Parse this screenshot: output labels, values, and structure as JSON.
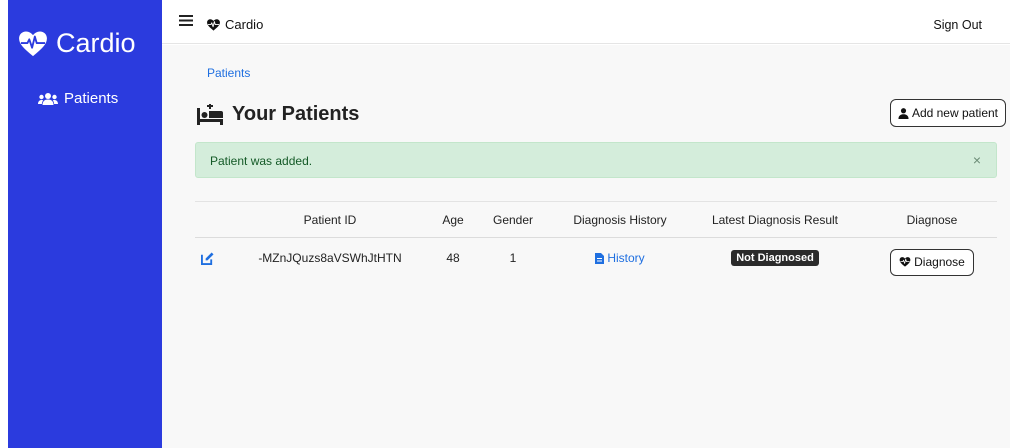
{
  "sidebar": {
    "brand": "Cardio",
    "items": [
      {
        "label": "Patients",
        "icon": "users-icon"
      }
    ]
  },
  "topbar": {
    "brand": "Cardio",
    "signout_label": "Sign Out"
  },
  "breadcrumb": "Patients",
  "page": {
    "title": "Your Patients",
    "add_button_label": "Add new patient"
  },
  "alert": {
    "message": "Patient was added.",
    "close_label": "×"
  },
  "table": {
    "headers": {
      "patient_id": "Patient ID",
      "age": "Age",
      "gender": "Gender",
      "history": "Diagnosis History",
      "result": "Latest Diagnosis Result",
      "diagnose": "Diagnose"
    },
    "rows": [
      {
        "patient_id": "-MZnJQuzs8aVSWhJtHTN",
        "age": "48",
        "gender": "1",
        "history_label": "History",
        "result": "Not Diagnosed",
        "diagnose_label": "Diagnose"
      }
    ]
  },
  "colors": {
    "sidebar_bg": "#2b3bde",
    "link": "#1f6fe0",
    "alert_bg": "#d4eddb",
    "alert_text": "#145a27",
    "badge_bg": "#2b2b2b"
  }
}
